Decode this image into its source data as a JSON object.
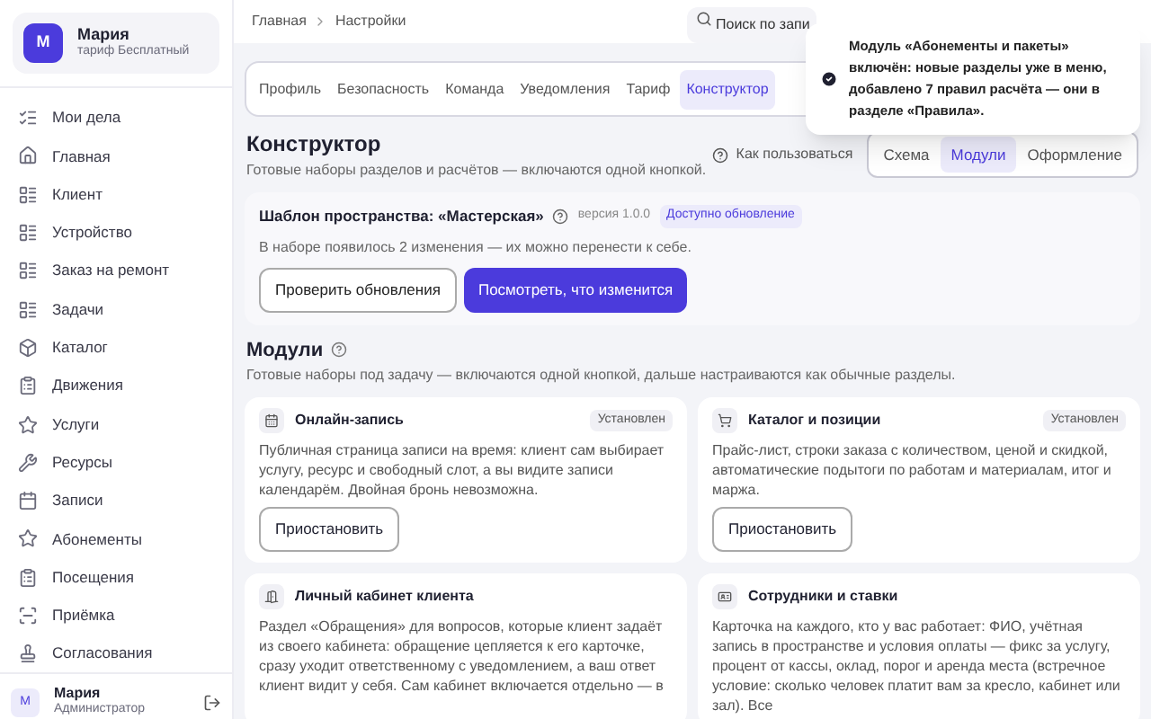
{
  "account": {
    "avatar": "М",
    "name": "Мария",
    "plan": "тариф Бесплатный"
  },
  "nav": [
    {
      "label": "Мои дела",
      "selected": false
    },
    {
      "label": "Главная",
      "selected": false
    },
    {
      "label": "Клиент",
      "selected": false
    },
    {
      "label": "Устройство",
      "selected": false
    },
    {
      "label": "Заказ на ремонт",
      "selected": false
    },
    {
      "label": "Задачи",
      "selected": false
    },
    {
      "label": "Каталог",
      "selected": false
    },
    {
      "label": "Движения",
      "selected": false
    },
    {
      "label": "Услуги",
      "selected": false
    },
    {
      "label": "Ресурсы",
      "selected": false
    },
    {
      "label": "Записи",
      "selected": false
    },
    {
      "label": "Абонементы",
      "selected": false
    },
    {
      "label": "Посещения",
      "selected": false
    },
    {
      "label": "Приёмка",
      "selected": false
    },
    {
      "label": "Согласования",
      "selected": false
    }
  ],
  "user": {
    "avatar": "М",
    "name": "Мария",
    "role": "Администратор"
  },
  "breadcrumbs": [
    "Главная",
    "Настройки"
  ],
  "search": {
    "placeholder": "Поиск по запи"
  },
  "tabs": [
    {
      "label": "Профиль",
      "selected": false
    },
    {
      "label": "Безопасность",
      "selected": false
    },
    {
      "label": "Команда",
      "selected": false
    },
    {
      "label": "Уведомления",
      "selected": false
    },
    {
      "label": "Тариф",
      "selected": false
    },
    {
      "label": "Конструктор",
      "selected": true
    }
  ],
  "page": {
    "title": "Конструктор",
    "subtitle": "Готовые наборы разделов и расчётов — включаются одной кнопкой.",
    "help": "Как пользоваться"
  },
  "views": [
    {
      "label": "Схема",
      "selected": false
    },
    {
      "label": "Модули",
      "selected": true
    },
    {
      "label": "Оформление",
      "selected": false
    }
  ],
  "template": {
    "title": "Шаблон пространства: «Мастерская»",
    "version": "версия 1.0.0",
    "badge": "Доступно обновление",
    "text": "В наборе появилось 2 изменения — их можно перенести к себе.",
    "buttons": [
      {
        "label": "Проверить обновления",
        "kind": "secondary"
      },
      {
        "label": "Посмотреть, что изменится",
        "kind": "primary"
      }
    ]
  },
  "modules": {
    "title": "Модули",
    "subtitle": "Готовые наборы под задачу — включаются одной кнопкой, дальше настраиваются как обычные разделы.",
    "items": [
      {
        "title": "Онлайн-запись",
        "status": "Установлен",
        "text": "Публичная страница записи на время: клиент сам выбирает услугу, ресурс и свободный слот, а вы видите записи календарём. Двойная бронь невозможна.",
        "button": "Приостановить"
      },
      {
        "title": "Каталог и позиции",
        "status": "Установлен",
        "text": "Прайс-лист, строки заказа с количеством, ценой и скидкой, автоматические подытоги по работам и материалам, итог и маржа.",
        "button": "Приостановить"
      },
      {
        "title": "Личный кабинет клиента",
        "text": "Раздел «Обращения» для вопросов, которые клиент задаёт из своего кабинета: обращение цепляется к его карточке, сразу уходит ответственному с уведомлением, а ваш ответ клиент видит у себя. Сам кабинет включается отдельно — в"
      },
      {
        "title": "Сотрудники и ставки",
        "text": "Карточка на каждого, кто у вас работает: ФИО, учётная запись в пространстве и условия оплаты — фикс за услугу, процент от кассы, оклад, порог и аренда места (встречное условие: сколько человек платит вам за кресло, кабинет или зал). Все"
      }
    ]
  },
  "toast": {
    "text": "Модуль «Абонементы и пакеты» включён: новые разделы уже в меню, добавлено 7 правил расчёта — они в разделе «Правила»."
  }
}
